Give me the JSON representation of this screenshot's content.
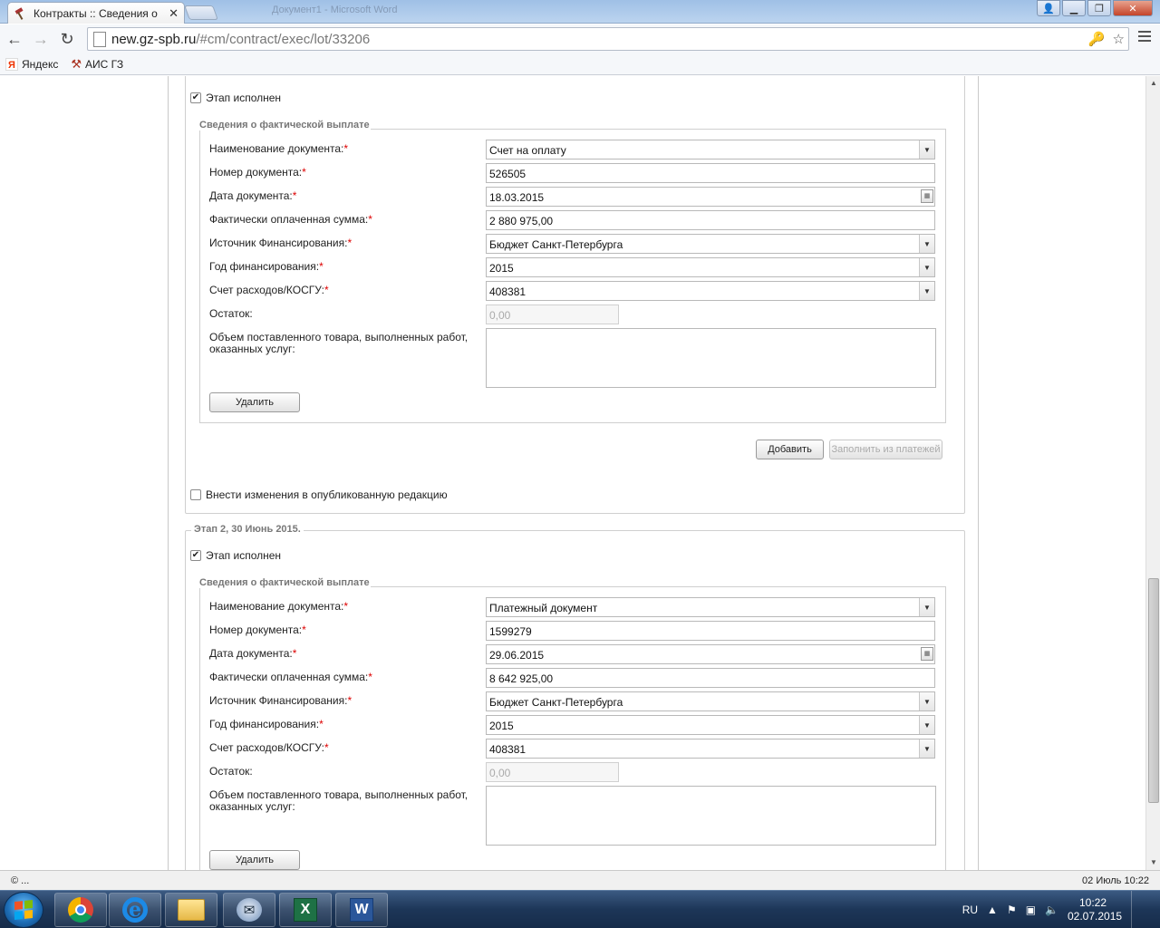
{
  "browser": {
    "tab_title": "Контракты :: Сведения о",
    "tab_close": "✕",
    "bg_title_1": "Документ1 - Microsoft Word",
    "url_host": "new.gz-spb.ru",
    "url_path": "/#cm/contract/exec/lot/33206",
    "bookmarks": [
      {
        "label": "Яндекс",
        "icon": "Я"
      },
      {
        "label": "АИС ГЗ",
        "icon": "⚒"
      }
    ]
  },
  "stage1": {
    "done_label": "Этап исполнен",
    "done_checked": true,
    "payment_legend": "Сведения о фактической выплате",
    "labels": {
      "doc_name": "Наименование документа:",
      "doc_number": "Номер документа:",
      "doc_date": "Дата документа:",
      "paid_sum": "Фактически оплаченная сумма:",
      "fin_source": "Источник Финансирования:",
      "fin_year": "Год финансирования:",
      "account": "Счет расходов/КОСГУ:",
      "remainder": "Остаток:",
      "volume": "Объем поставленного товара, выполненных работ, оказанных услуг:"
    },
    "values": {
      "doc_name": "Счет на оплату",
      "doc_number": "526505",
      "doc_date": "18.03.2015",
      "paid_sum": "2 880 975,00",
      "fin_source": "Бюджет Санкт-Петербурга",
      "fin_year": "2015",
      "account": "408381",
      "remainder": "0,00",
      "volume": ""
    },
    "delete_button": "Удалить",
    "add_button": "Добавить",
    "fill_button": "Заполнить из платежей",
    "amend_label": "Внести изменения в опубликованную редакцию",
    "amend_checked": false
  },
  "stage2": {
    "legend": "Этап 2, 30 Июнь 2015.",
    "done_label": "Этап исполнен",
    "done_checked": true,
    "payment_legend": "Сведения о фактической выплате",
    "labels": {
      "doc_name": "Наименование документа:",
      "doc_number": "Номер документа:",
      "doc_date": "Дата документа:",
      "paid_sum": "Фактически оплаченная сумма:",
      "fin_source": "Источник Финансирования:",
      "fin_year": "Год финансирования:",
      "account": "Счет расходов/КОСГУ:",
      "remainder": "Остаток:",
      "volume": "Объем поставленного товара, выполненных работ, оказанных услуг:"
    },
    "values": {
      "doc_name": "Платежный документ",
      "doc_number": "1599279",
      "doc_date": "29.06.2015",
      "paid_sum": "8 642 925,00",
      "fin_source": "Бюджет Санкт-Петербурга",
      "fin_year": "2015",
      "account": "408381",
      "remainder": "0,00",
      "volume": ""
    },
    "delete_button": "Удалить"
  },
  "required_mark": "*",
  "statusbar": {
    "left": "© ...",
    "right": "02 Июль 10:22"
  },
  "taskbar": {
    "lang": "RU",
    "time": "10:22",
    "date": "02.07.2015",
    "apps": [
      "chrome-icon",
      "ie-icon",
      "explorer-icon",
      "mail-icon",
      "excel-icon",
      "word-icon"
    ]
  },
  "colors": {
    "required": "#dd0000",
    "legend": "#777777",
    "taskbar": "#1d3658"
  }
}
